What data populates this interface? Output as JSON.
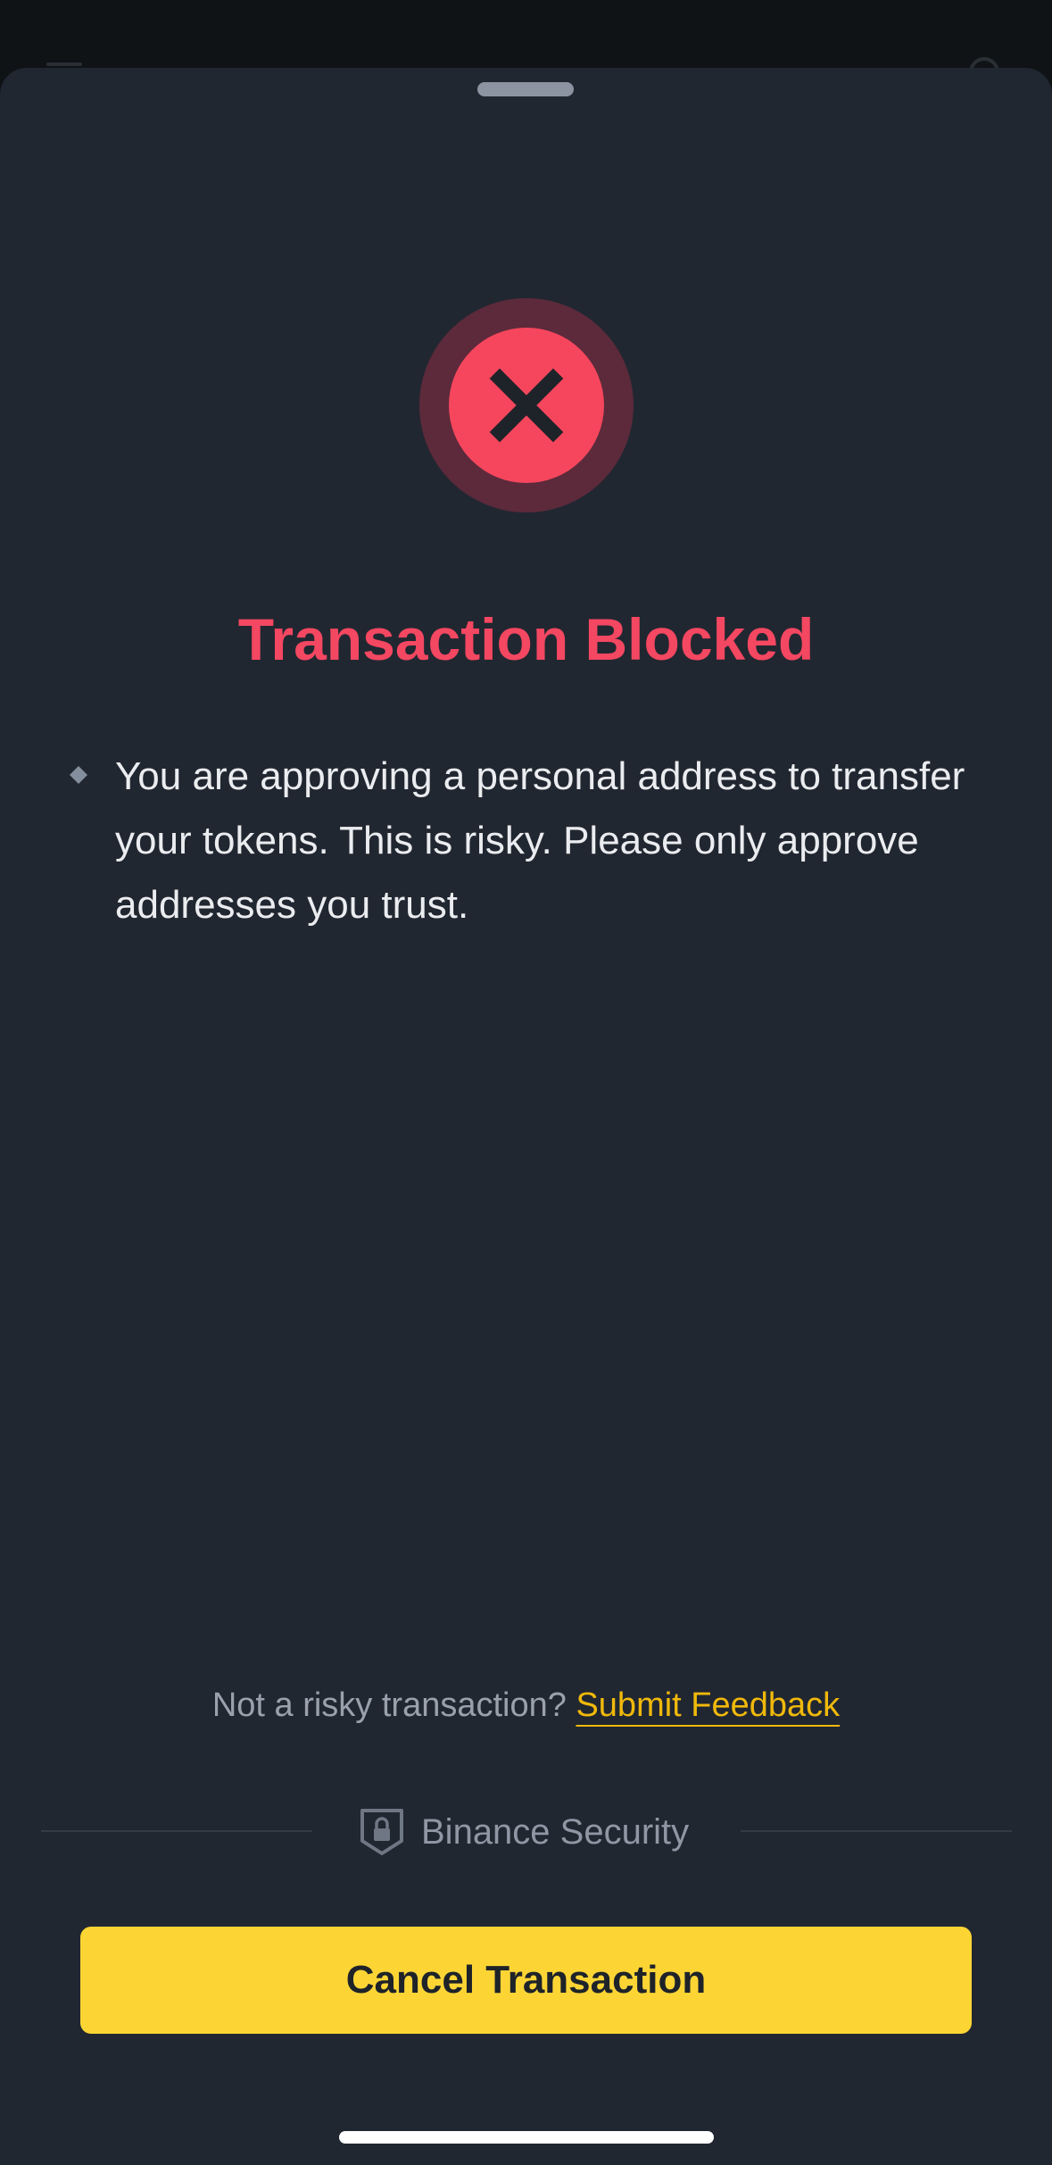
{
  "sheet": {
    "icon": "error-x-icon",
    "title": "Transaction Blocked",
    "warnings": [
      "You are approving a personal address to transfer your tokens. This is risky. Please only approve addresses you trust."
    ],
    "feedback": {
      "question": "Not a risky transaction?",
      "link_label": "Submit Feedback"
    },
    "security": {
      "icon": "shield-lock-icon",
      "label": "Binance Security"
    },
    "cancel_button_label": "Cancel Transaction"
  },
  "colors": {
    "background": "#212731",
    "error": "#f44761",
    "accent": "#fcd535",
    "link": "#f0b90b",
    "text": "#eaecef",
    "muted": "#9aa1ad"
  }
}
